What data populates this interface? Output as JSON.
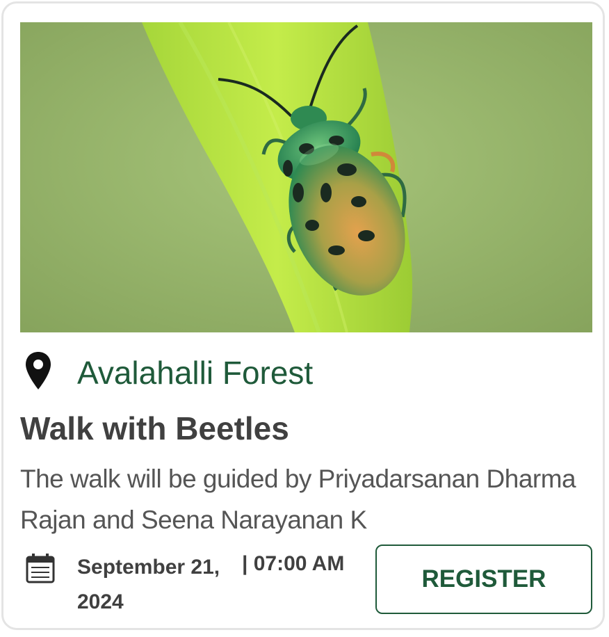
{
  "event": {
    "image": {
      "subject": "green jewel beetle with black spots on a grass blade",
      "colors": {
        "background": "#9bb872",
        "leaf": "#b8e240",
        "beetle": "#4f9e4a",
        "beetle_highlight": "#e0a04a",
        "spots": "#1a2a20"
      }
    },
    "location": {
      "icon": "map-pin-icon",
      "name": "Avalahalli Forest"
    },
    "title": "Walk with Beetles",
    "description": "The walk will be guided by Priyadarsanan Dharma Rajan and Seena Narayanan K",
    "schedule": {
      "icon": "calendar-icon",
      "date": "September 21, 2024",
      "time": "| 07:00 AM"
    },
    "register_label": "REGISTER"
  },
  "colors": {
    "accent": "#1f5a3a",
    "title_text": "#404040",
    "body_text": "#555555",
    "card_border": "#e4e4e4"
  }
}
